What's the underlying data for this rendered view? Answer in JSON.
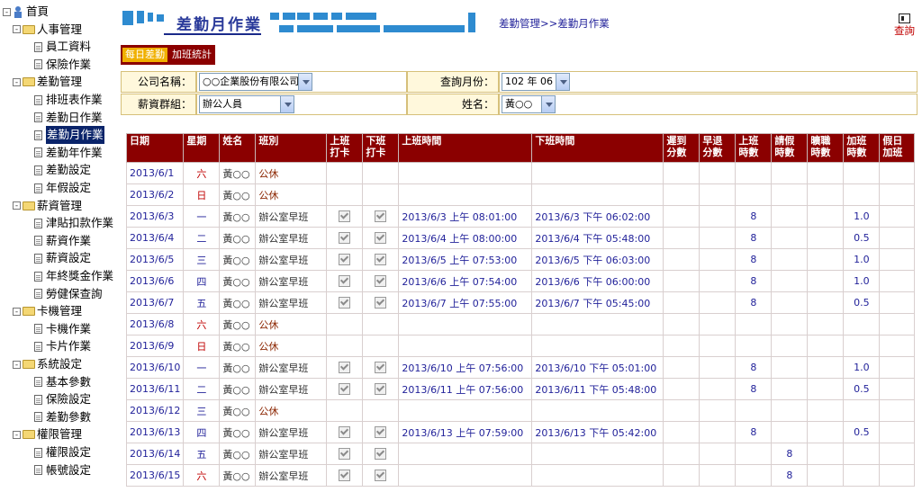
{
  "sidebar": {
    "home": "首頁",
    "groups": [
      {
        "label": "人事管理",
        "items": [
          "員工資料",
          "保險作業"
        ]
      },
      {
        "label": "差勤管理",
        "items": [
          "排班表作業",
          "差勤日作業",
          "差勤月作業",
          "差勤年作業",
          "差勤設定",
          "年假設定"
        ]
      },
      {
        "label": "薪資管理",
        "items": [
          "津貼扣款作業",
          "薪資作業",
          "薪資設定",
          "年終獎金作業",
          "勞健保查詢"
        ]
      },
      {
        "label": "卡機管理",
        "items": [
          "卡機作業",
          "卡片作業"
        ]
      },
      {
        "label": "系統設定",
        "items": [
          "基本參數",
          "保險設定",
          "差勤參數"
        ]
      },
      {
        "label": "權限管理",
        "items": [
          "權限設定",
          "帳號設定"
        ]
      }
    ]
  },
  "header": {
    "title": "差勤月作業",
    "breadcrumb": "差勤管理>>差勤月作業",
    "query_label": "查詢"
  },
  "tabs": [
    "每日差勤",
    "加班統計"
  ],
  "filters": {
    "company_label": "公司名稱：",
    "company_value": "○○企業股份有限公司",
    "month_label": "查詢月份：",
    "month_value": "102 年 06 月",
    "group_label": "薪資群組：",
    "group_value": "辦公人員",
    "name_label": "姓名：",
    "name_value": "黃○○"
  },
  "table": {
    "headers": [
      "日期",
      "星期",
      "姓名",
      "班別",
      "上班\n打卡",
      "下班\n打卡",
      "上班時間",
      "下班時間",
      "遲到\n分數",
      "早退\n分數",
      "上班\n時數",
      "請假\n時數",
      "曠職\n時數",
      "加班\n時數",
      "假日\n加班"
    ],
    "rows": [
      {
        "date": "2013/6/1",
        "wd": "六",
        "name": "黃○○",
        "shift": "公休",
        "in_chk": false,
        "out_chk": false,
        "in": "",
        "out": "",
        "late": "",
        "early": "",
        "work": "",
        "leave": "",
        "absent": "",
        "ot": "",
        "hol": ""
      },
      {
        "date": "2013/6/2",
        "wd": "日",
        "name": "黃○○",
        "shift": "公休",
        "in_chk": false,
        "out_chk": false,
        "in": "",
        "out": "",
        "late": "",
        "early": "",
        "work": "",
        "leave": "",
        "absent": "",
        "ot": "",
        "hol": ""
      },
      {
        "date": "2013/6/3",
        "wd": "一",
        "name": "黃○○",
        "shift": "辦公室早班",
        "in_chk": true,
        "out_chk": true,
        "in": "2013/6/3 上午 08:01:00",
        "out": "2013/6/3 下午 06:02:00",
        "late": "",
        "early": "",
        "work": "8",
        "leave": "",
        "absent": "",
        "ot": "1.0",
        "hol": ""
      },
      {
        "date": "2013/6/4",
        "wd": "二",
        "name": "黃○○",
        "shift": "辦公室早班",
        "in_chk": true,
        "out_chk": true,
        "in": "2013/6/4 上午 08:00:00",
        "out": "2013/6/4 下午 05:48:00",
        "late": "",
        "early": "",
        "work": "8",
        "leave": "",
        "absent": "",
        "ot": "0.5",
        "hol": ""
      },
      {
        "date": "2013/6/5",
        "wd": "三",
        "name": "黃○○",
        "shift": "辦公室早班",
        "in_chk": true,
        "out_chk": true,
        "in": "2013/6/5 上午 07:53:00",
        "out": "2013/6/5 下午 06:03:00",
        "late": "",
        "early": "",
        "work": "8",
        "leave": "",
        "absent": "",
        "ot": "1.0",
        "hol": ""
      },
      {
        "date": "2013/6/6",
        "wd": "四",
        "name": "黃○○",
        "shift": "辦公室早班",
        "in_chk": true,
        "out_chk": true,
        "in": "2013/6/6 上午 07:54:00",
        "out": "2013/6/6 下午 06:00:00",
        "late": "",
        "early": "",
        "work": "8",
        "leave": "",
        "absent": "",
        "ot": "1.0",
        "hol": ""
      },
      {
        "date": "2013/6/7",
        "wd": "五",
        "name": "黃○○",
        "shift": "辦公室早班",
        "in_chk": true,
        "out_chk": true,
        "in": "2013/6/7 上午 07:55:00",
        "out": "2013/6/7 下午 05:45:00",
        "late": "",
        "early": "",
        "work": "8",
        "leave": "",
        "absent": "",
        "ot": "0.5",
        "hol": ""
      },
      {
        "date": "2013/6/8",
        "wd": "六",
        "name": "黃○○",
        "shift": "公休",
        "in_chk": false,
        "out_chk": false,
        "in": "",
        "out": "",
        "late": "",
        "early": "",
        "work": "",
        "leave": "",
        "absent": "",
        "ot": "",
        "hol": ""
      },
      {
        "date": "2013/6/9",
        "wd": "日",
        "name": "黃○○",
        "shift": "公休",
        "in_chk": false,
        "out_chk": false,
        "in": "",
        "out": "",
        "late": "",
        "early": "",
        "work": "",
        "leave": "",
        "absent": "",
        "ot": "",
        "hol": ""
      },
      {
        "date": "2013/6/10",
        "wd": "一",
        "name": "黃○○",
        "shift": "辦公室早班",
        "in_chk": true,
        "out_chk": true,
        "in": "2013/6/10 上午 07:56:00",
        "out": "2013/6/10 下午 05:01:00",
        "late": "",
        "early": "",
        "work": "8",
        "leave": "",
        "absent": "",
        "ot": "1.0",
        "hol": ""
      },
      {
        "date": "2013/6/11",
        "wd": "二",
        "name": "黃○○",
        "shift": "辦公室早班",
        "in_chk": true,
        "out_chk": true,
        "in": "2013/6/11 上午 07:56:00",
        "out": "2013/6/11 下午 05:48:00",
        "late": "",
        "early": "",
        "work": "8",
        "leave": "",
        "absent": "",
        "ot": "0.5",
        "hol": ""
      },
      {
        "date": "2013/6/12",
        "wd": "三",
        "name": "黃○○",
        "shift": "公休",
        "in_chk": false,
        "out_chk": false,
        "in": "",
        "out": "",
        "late": "",
        "early": "",
        "work": "",
        "leave": "",
        "absent": "",
        "ot": "",
        "hol": ""
      },
      {
        "date": "2013/6/13",
        "wd": "四",
        "name": "黃○○",
        "shift": "辦公室早班",
        "in_chk": true,
        "out_chk": true,
        "in": "2013/6/13 上午 07:59:00",
        "out": "2013/6/13 下午 05:42:00",
        "late": "",
        "early": "",
        "work": "8",
        "leave": "",
        "absent": "",
        "ot": "0.5",
        "hol": ""
      },
      {
        "date": "2013/6/14",
        "wd": "五",
        "name": "黃○○",
        "shift": "辦公室早班",
        "in_chk": true,
        "out_chk": true,
        "in": "",
        "out": "",
        "late": "",
        "early": "",
        "work": "",
        "leave": "8",
        "absent": "",
        "ot": "",
        "hol": ""
      },
      {
        "date": "2013/6/15",
        "wd": "六",
        "name": "黃○○",
        "shift": "辦公室早班",
        "in_chk": true,
        "out_chk": true,
        "in": "",
        "out": "",
        "late": "",
        "early": "",
        "work": "",
        "leave": "8",
        "absent": "",
        "ot": "",
        "hol": ""
      }
    ]
  },
  "colors": {
    "header_bg": "#8b0000",
    "date_text": "#22229a",
    "weekend_text": "#c00000",
    "banner_blue": "#2e8bd0"
  },
  "icons": {
    "home": "home-icon",
    "folder": "folder-icon",
    "doc": "document-icon",
    "query": "query-icon"
  }
}
